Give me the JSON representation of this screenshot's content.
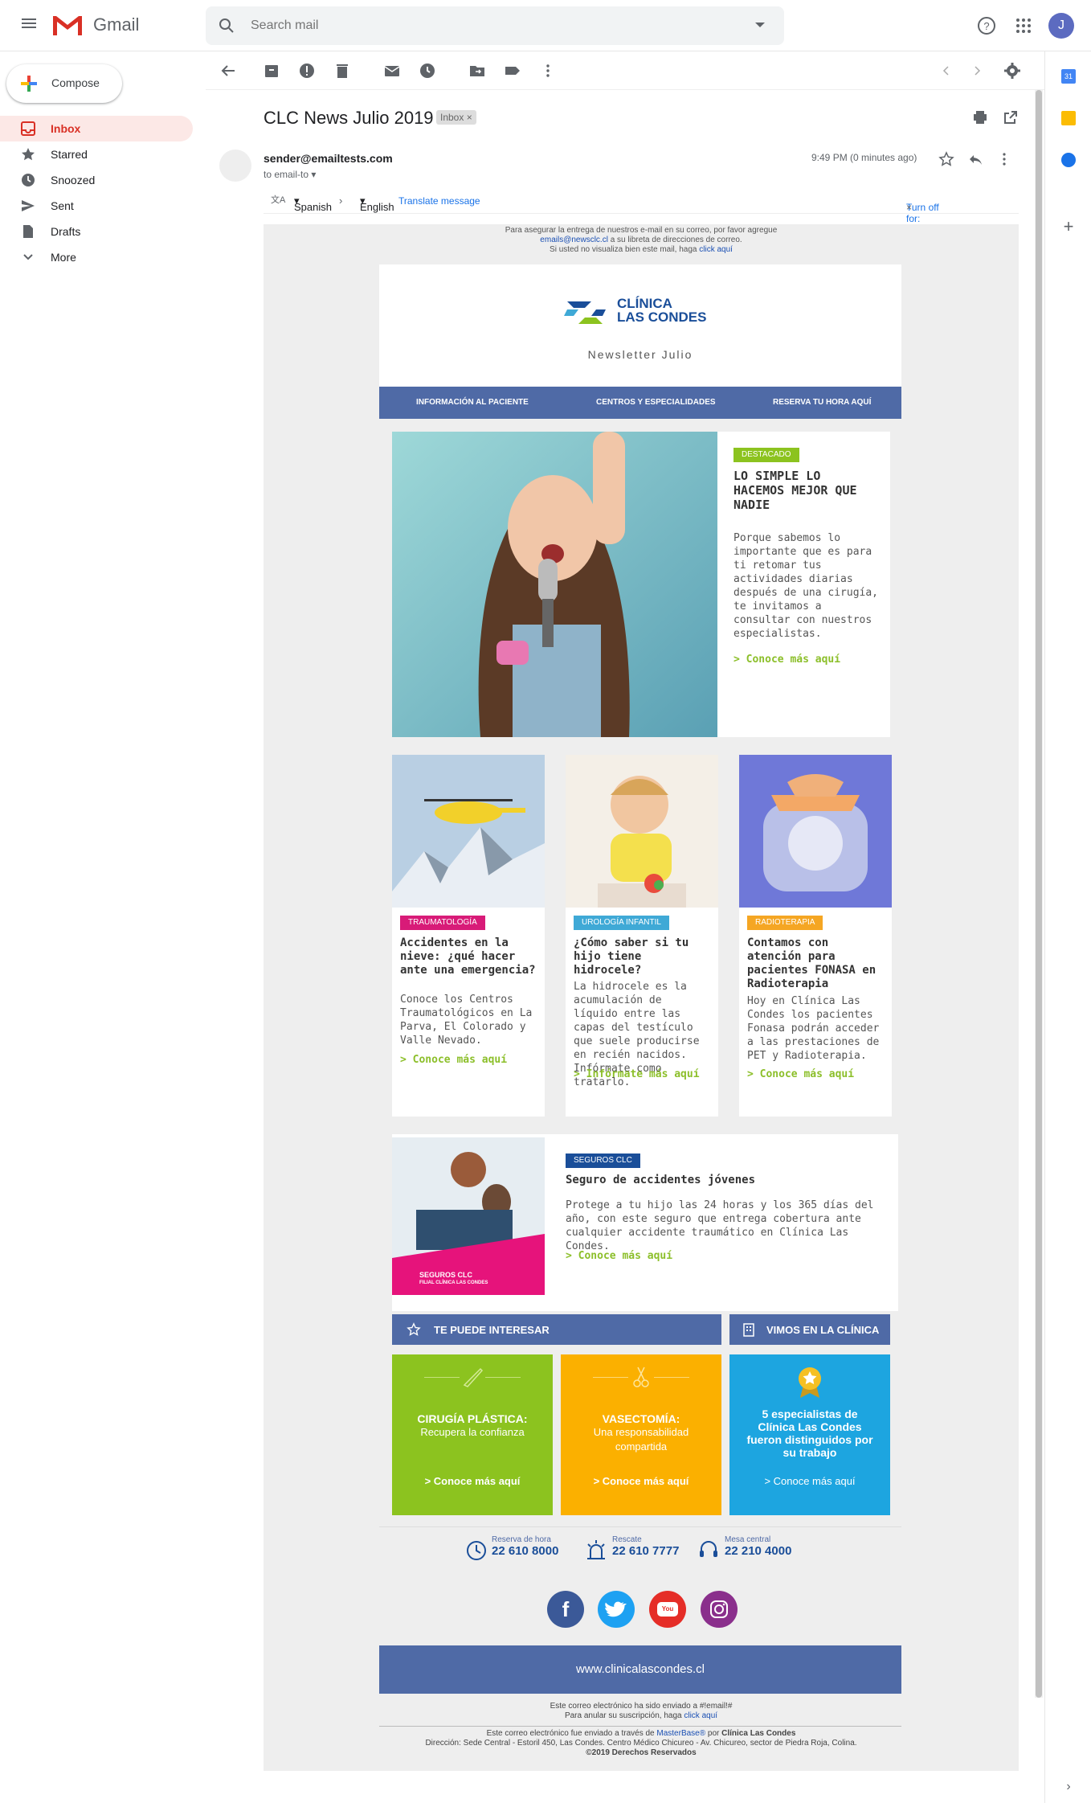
{
  "app": {
    "name": "Gmail",
    "avatar_letter": "J"
  },
  "search": {
    "placeholder": "Search mail"
  },
  "sidebar": {
    "compose": "Compose",
    "items": [
      {
        "label": "Inbox",
        "active": true
      },
      {
        "label": "Starred"
      },
      {
        "label": "Snoozed"
      },
      {
        "label": "Sent"
      },
      {
        "label": "Drafts"
      },
      {
        "label": "More"
      }
    ]
  },
  "message": {
    "subject": "CLC News Julio 2019",
    "label_chip": "Inbox",
    "sender": "sender@emailtests.com",
    "to": "to email-to",
    "time": "9:49 PM (0 minutes ago)"
  },
  "translate": {
    "from": "Spanish",
    "to": "English",
    "action": "Translate message",
    "turn_off": "Turn off for: Spanish"
  },
  "email": {
    "preheader": {
      "line1": "Para asegurar la entrega de nuestros e-mail en su correo, por favor agregue",
      "email": "emails@newsclc.cl",
      "line2": " a su libreta de direcciones de correo.",
      "line3": "Si usted no visualiza bien este mail, haga ",
      "link": "click aquí"
    },
    "brand": {
      "line1": "CLÍNICA",
      "line2": "LAS CONDES"
    },
    "newsletter": "Newsletter Julio",
    "menu": [
      "INFORMACIÓN AL PACIENTE",
      "CENTROS Y ESPECIALIDADES",
      "RESERVA TU HORA AQUÍ"
    ],
    "hero": {
      "tag": "DESTACADO",
      "title": "LO SIMPLE LO HACEMOS MEJOR QUE NADIE",
      "text": "Porque sabemos lo importante que es para ti retomar tus actividades diarias después de una cirugía, te invitamos a consultar con nuestros especialistas.",
      "link": "> Conoce más aquí"
    },
    "articles": [
      {
        "tag": "TRAUMATOLOGÍA",
        "tag_color": "#d81b78",
        "title": "Accidentes en la nieve: ¿qué hacer ante una emergencia?",
        "text": "Conoce los Centros Traumatológicos en La Parva, El Colorado y Valle Nevado.",
        "link": "> Conoce más aquí"
      },
      {
        "tag": "UROLOGÍA INFANTIL",
        "tag_color": "#3fa9d6",
        "title": "¿Cómo saber si tu hijo tiene hidrocele?",
        "text": "La hidrocele es la acumulación de líquido entre las capas del testículo que suele producirse en recién nacidos. Infórmate como tratarlo.",
        "link": "> Infórmate más aquí"
      },
      {
        "tag": "RADIOTERAPIA",
        "tag_color": "#f5a623",
        "title": "Contamos con atención para pacientes FONASA en Radioterapia",
        "text": "Hoy en Clínica Las Condes los pacientes Fonasa podrán acceder a las prestaciones de PET y Radioterapia.",
        "link": "> Conoce más aquí"
      }
    ],
    "seguro": {
      "tag": "SEGUROS CLC",
      "title": "Seguro de accidentes jóvenes",
      "text": "Protege a tu hijo las 24 horas y los 365 días del año, con este seguro que entrega cobertura ante cualquier accidente traumático en Clínica Las Condes.",
      "link": "> Conoce más aquí",
      "logo_line1": "SEGUROS CLC",
      "logo_line2": "FILIAL CLÍNICA LAS CONDES"
    },
    "section1": "TE PUEDE INTERESAR",
    "section2": "VIMOS EN LA CLÍNICA",
    "tiles": [
      {
        "title": "CIRUGÍA PLÁSTICA:",
        "sub": "Recupera la confianza",
        "link": "> Conoce más aquí",
        "color": "#8cc31f"
      },
      {
        "title": "VASECTOMÍA:",
        "sub": "Una responsabilidad compartida",
        "link": "> Conoce más aquí",
        "color": "#fbb000"
      },
      {
        "title": "5 especialistas de Clínica Las Condes fueron distinguidos por su trabajo",
        "sub": "",
        "link": "> Conoce más aquí",
        "color": "#1da5e0"
      }
    ],
    "contacts": [
      {
        "label": "Reserva de hora",
        "number": "22 610 8000"
      },
      {
        "label": "Rescate",
        "number": "22 610 7777"
      },
      {
        "label": "Mesa central",
        "number": "22 210 4000"
      }
    ],
    "social": [
      "facebook",
      "twitter",
      "youtube",
      "instagram"
    ],
    "website": "www.clinicalascondes.cl",
    "fine1": "Este correo electrónico ha sido enviado a #!email!#",
    "fine2": "Para anular su suscripción, haga ",
    "fine2_link": "click aquí",
    "fine3a": "Este correo electrónico fue enviado a través de ",
    "fine3_mb": "MasterBase®",
    "fine3b": " por ",
    "fine3_c": "Clínica Las Condes",
    "fine4": "Dirección: Sede Central - Estoril 450, Las Condes. Centro Médico Chicureo - Av. Chicureo, sector de Piedra Roja, Colina.",
    "fine5": "©2019 Derechos Reservados"
  }
}
